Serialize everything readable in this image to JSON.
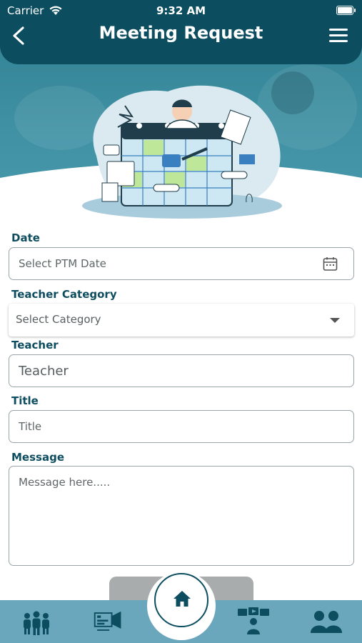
{
  "status": {
    "carrier": "Carrier",
    "time": "9:32 AM"
  },
  "header": {
    "title": "Meeting Request"
  },
  "form": {
    "date_label": "Date",
    "date_placeholder": "Select PTM Date",
    "teacher_category_label": "Teacher Category",
    "teacher_category_value": "Select Category",
    "teacher_label": "Teacher",
    "teacher_placeholder": "Teacher",
    "title_label": "Title",
    "title_placeholder": "Title",
    "message_label": "Message",
    "message_placeholder": "Message here....."
  },
  "nav": {
    "items": [
      "group-icon",
      "announcement-icon",
      "home-icon",
      "video-conference-icon",
      "parent-teacher-icon"
    ]
  },
  "colors": {
    "primary": "#0c4e60",
    "nav_bg": "#6aa7bd",
    "hero": "#3f91a3"
  }
}
